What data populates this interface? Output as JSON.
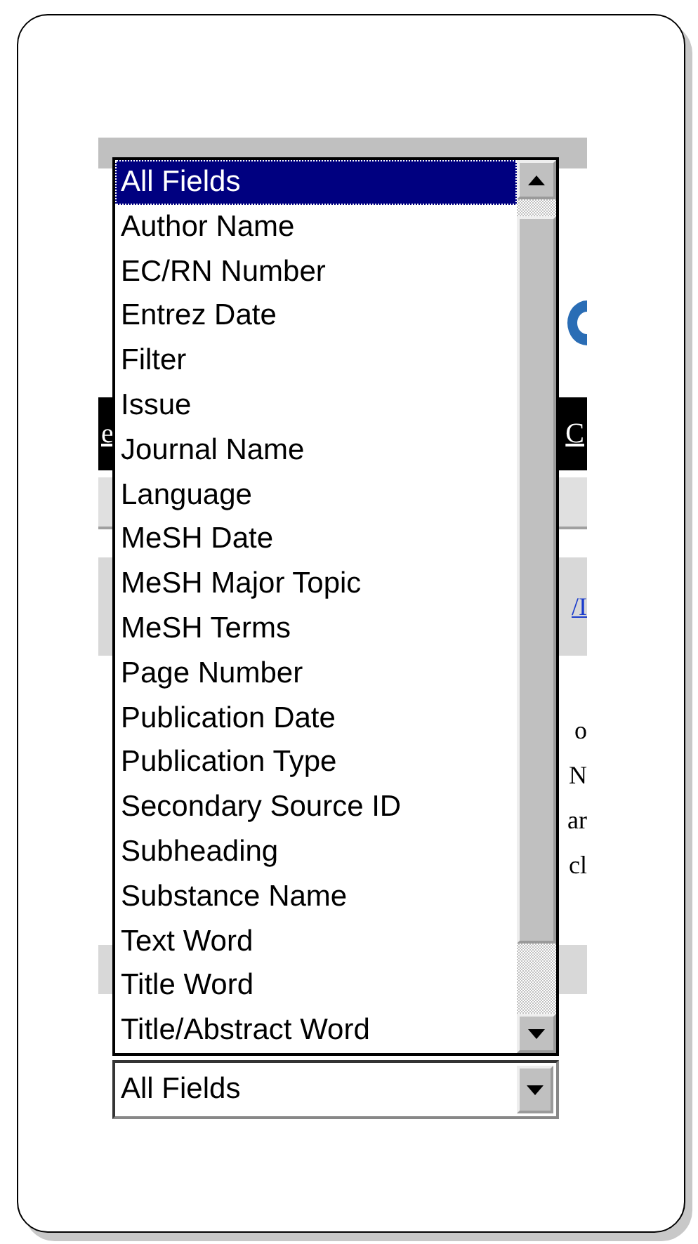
{
  "page_behind": {
    "nav_left": "e",
    "nav_right": "C",
    "link": "/I",
    "fragments": [
      "o",
      "N",
      "ar",
      "cl"
    ]
  },
  "dropdown": {
    "options": [
      {
        "label": "All Fields",
        "selected": true
      },
      {
        "label": "Author Name",
        "selected": false
      },
      {
        "label": "EC/RN Number",
        "selected": false
      },
      {
        "label": "Entrez Date",
        "selected": false
      },
      {
        "label": "Filter",
        "selected": false
      },
      {
        "label": "Issue",
        "selected": false
      },
      {
        "label": "Journal Name",
        "selected": false
      },
      {
        "label": "Language",
        "selected": false
      },
      {
        "label": "MeSH Date",
        "selected": false
      },
      {
        "label": "MeSH Major Topic",
        "selected": false
      },
      {
        "label": "MeSH Terms",
        "selected": false
      },
      {
        "label": "Page Number",
        "selected": false
      },
      {
        "label": "Publication Date",
        "selected": false
      },
      {
        "label": "Publication Type",
        "selected": false
      },
      {
        "label": "Secondary Source ID",
        "selected": false
      },
      {
        "label": "Subheading",
        "selected": false
      },
      {
        "label": "Substance Name",
        "selected": false
      },
      {
        "label": "Text Word",
        "selected": false
      },
      {
        "label": "Title Word",
        "selected": false
      },
      {
        "label": "Title/Abstract Word",
        "selected": false
      }
    ],
    "value": "All Fields"
  }
}
